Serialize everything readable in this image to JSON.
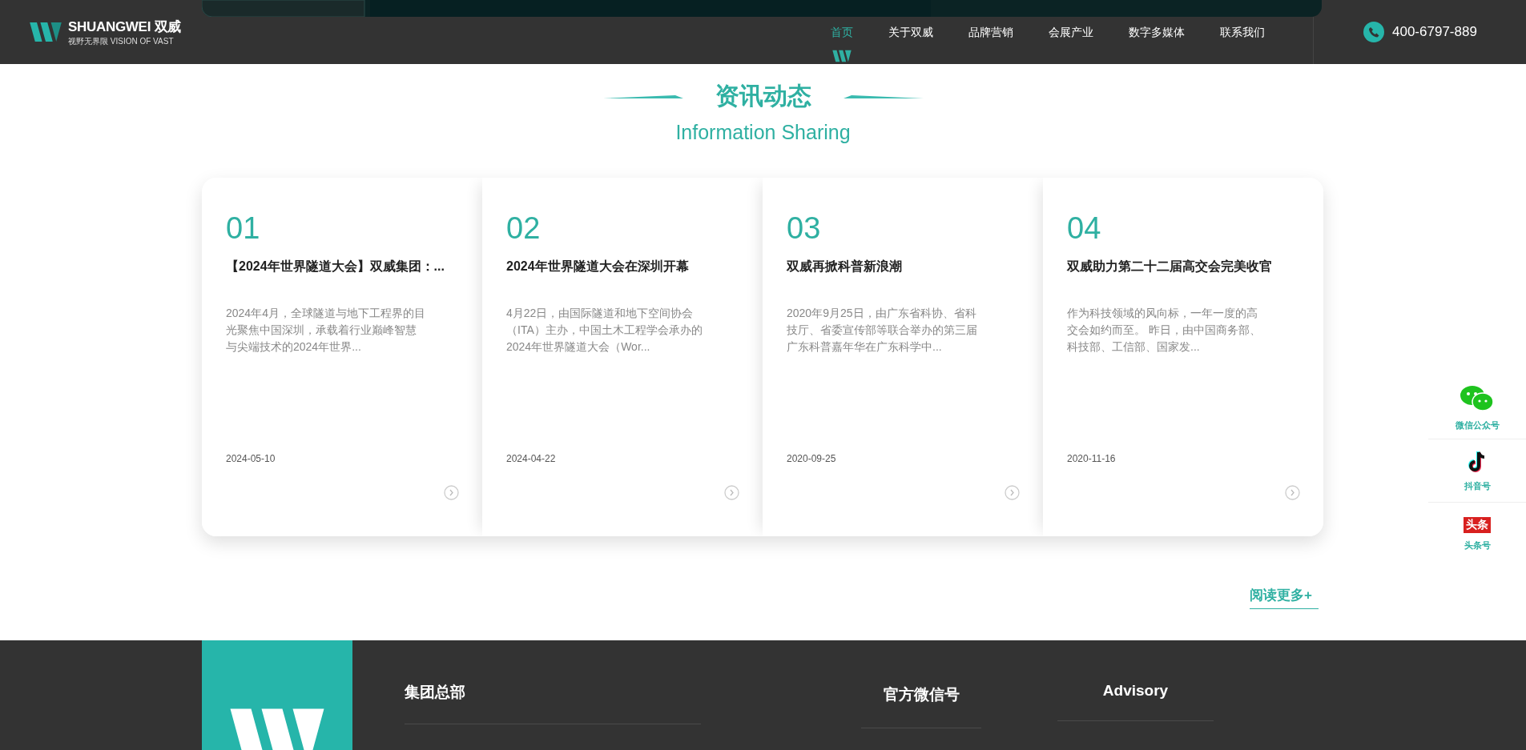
{
  "header": {
    "logo": {
      "name": "SHUANGWEI 双威",
      "tagline": "视野无界限 VISION OF VAST"
    },
    "nav": [
      {
        "label": "首页",
        "selected": true
      },
      {
        "label": "关于双威",
        "selected": false
      },
      {
        "label": "品牌营销",
        "selected": false
      },
      {
        "label": "会展产业",
        "selected": false
      },
      {
        "label": "数字多媒体",
        "selected": false
      },
      {
        "label": "联系我们",
        "selected": false
      }
    ],
    "phone": "400-6797-889"
  },
  "section": {
    "title": "资讯动态",
    "subtitle": "Information Sharing"
  },
  "news": [
    {
      "number": "01",
      "title": "【2024年世界隧道大会】双威集团：...",
      "summary": "2024年4月，全球隧道与地下工程界的目光聚焦中国深圳，承载着行业巅峰智慧与尖端技术的2024年世界...",
      "date": "2024-05-10"
    },
    {
      "number": "02",
      "title": "2024年世界隧道大会在深圳开幕",
      "summary": "4月22日，由国际隧道和地下空间协会（ITA）主办，中国土木工程学会承办的2024年世界隧道大会（Wor...",
      "date": "2024-04-22"
    },
    {
      "number": "03",
      "title": "双威再掀科普新浪潮",
      "summary": "2020年9月25日，由广东省科协、省科技厅、省委宣传部等联合举办的第三届广东科普嘉年华在广东科学中...",
      "date": "2020-09-25"
    },
    {
      "number": "04",
      "title": "双威助力第二十二届高交会完美收官",
      "summary": "作为科技领域的风向标，一年一度的高交会如约而至。 昨日，由中国商务部、科技部、工信部、国家发...",
      "date": "2020-11-16"
    }
  ],
  "read_more": "阅读更多+",
  "social": [
    {
      "kind": "wechat",
      "label": "微信公众号"
    },
    {
      "kind": "douyin",
      "label": "抖音号"
    },
    {
      "kind": "toutiao",
      "label": "头条号",
      "badge_text": "头条"
    }
  ],
  "footer": {
    "columns": [
      {
        "title": "集团总部"
      },
      {
        "title": "官方微信号"
      },
      {
        "title": "Advisory"
      }
    ]
  }
}
